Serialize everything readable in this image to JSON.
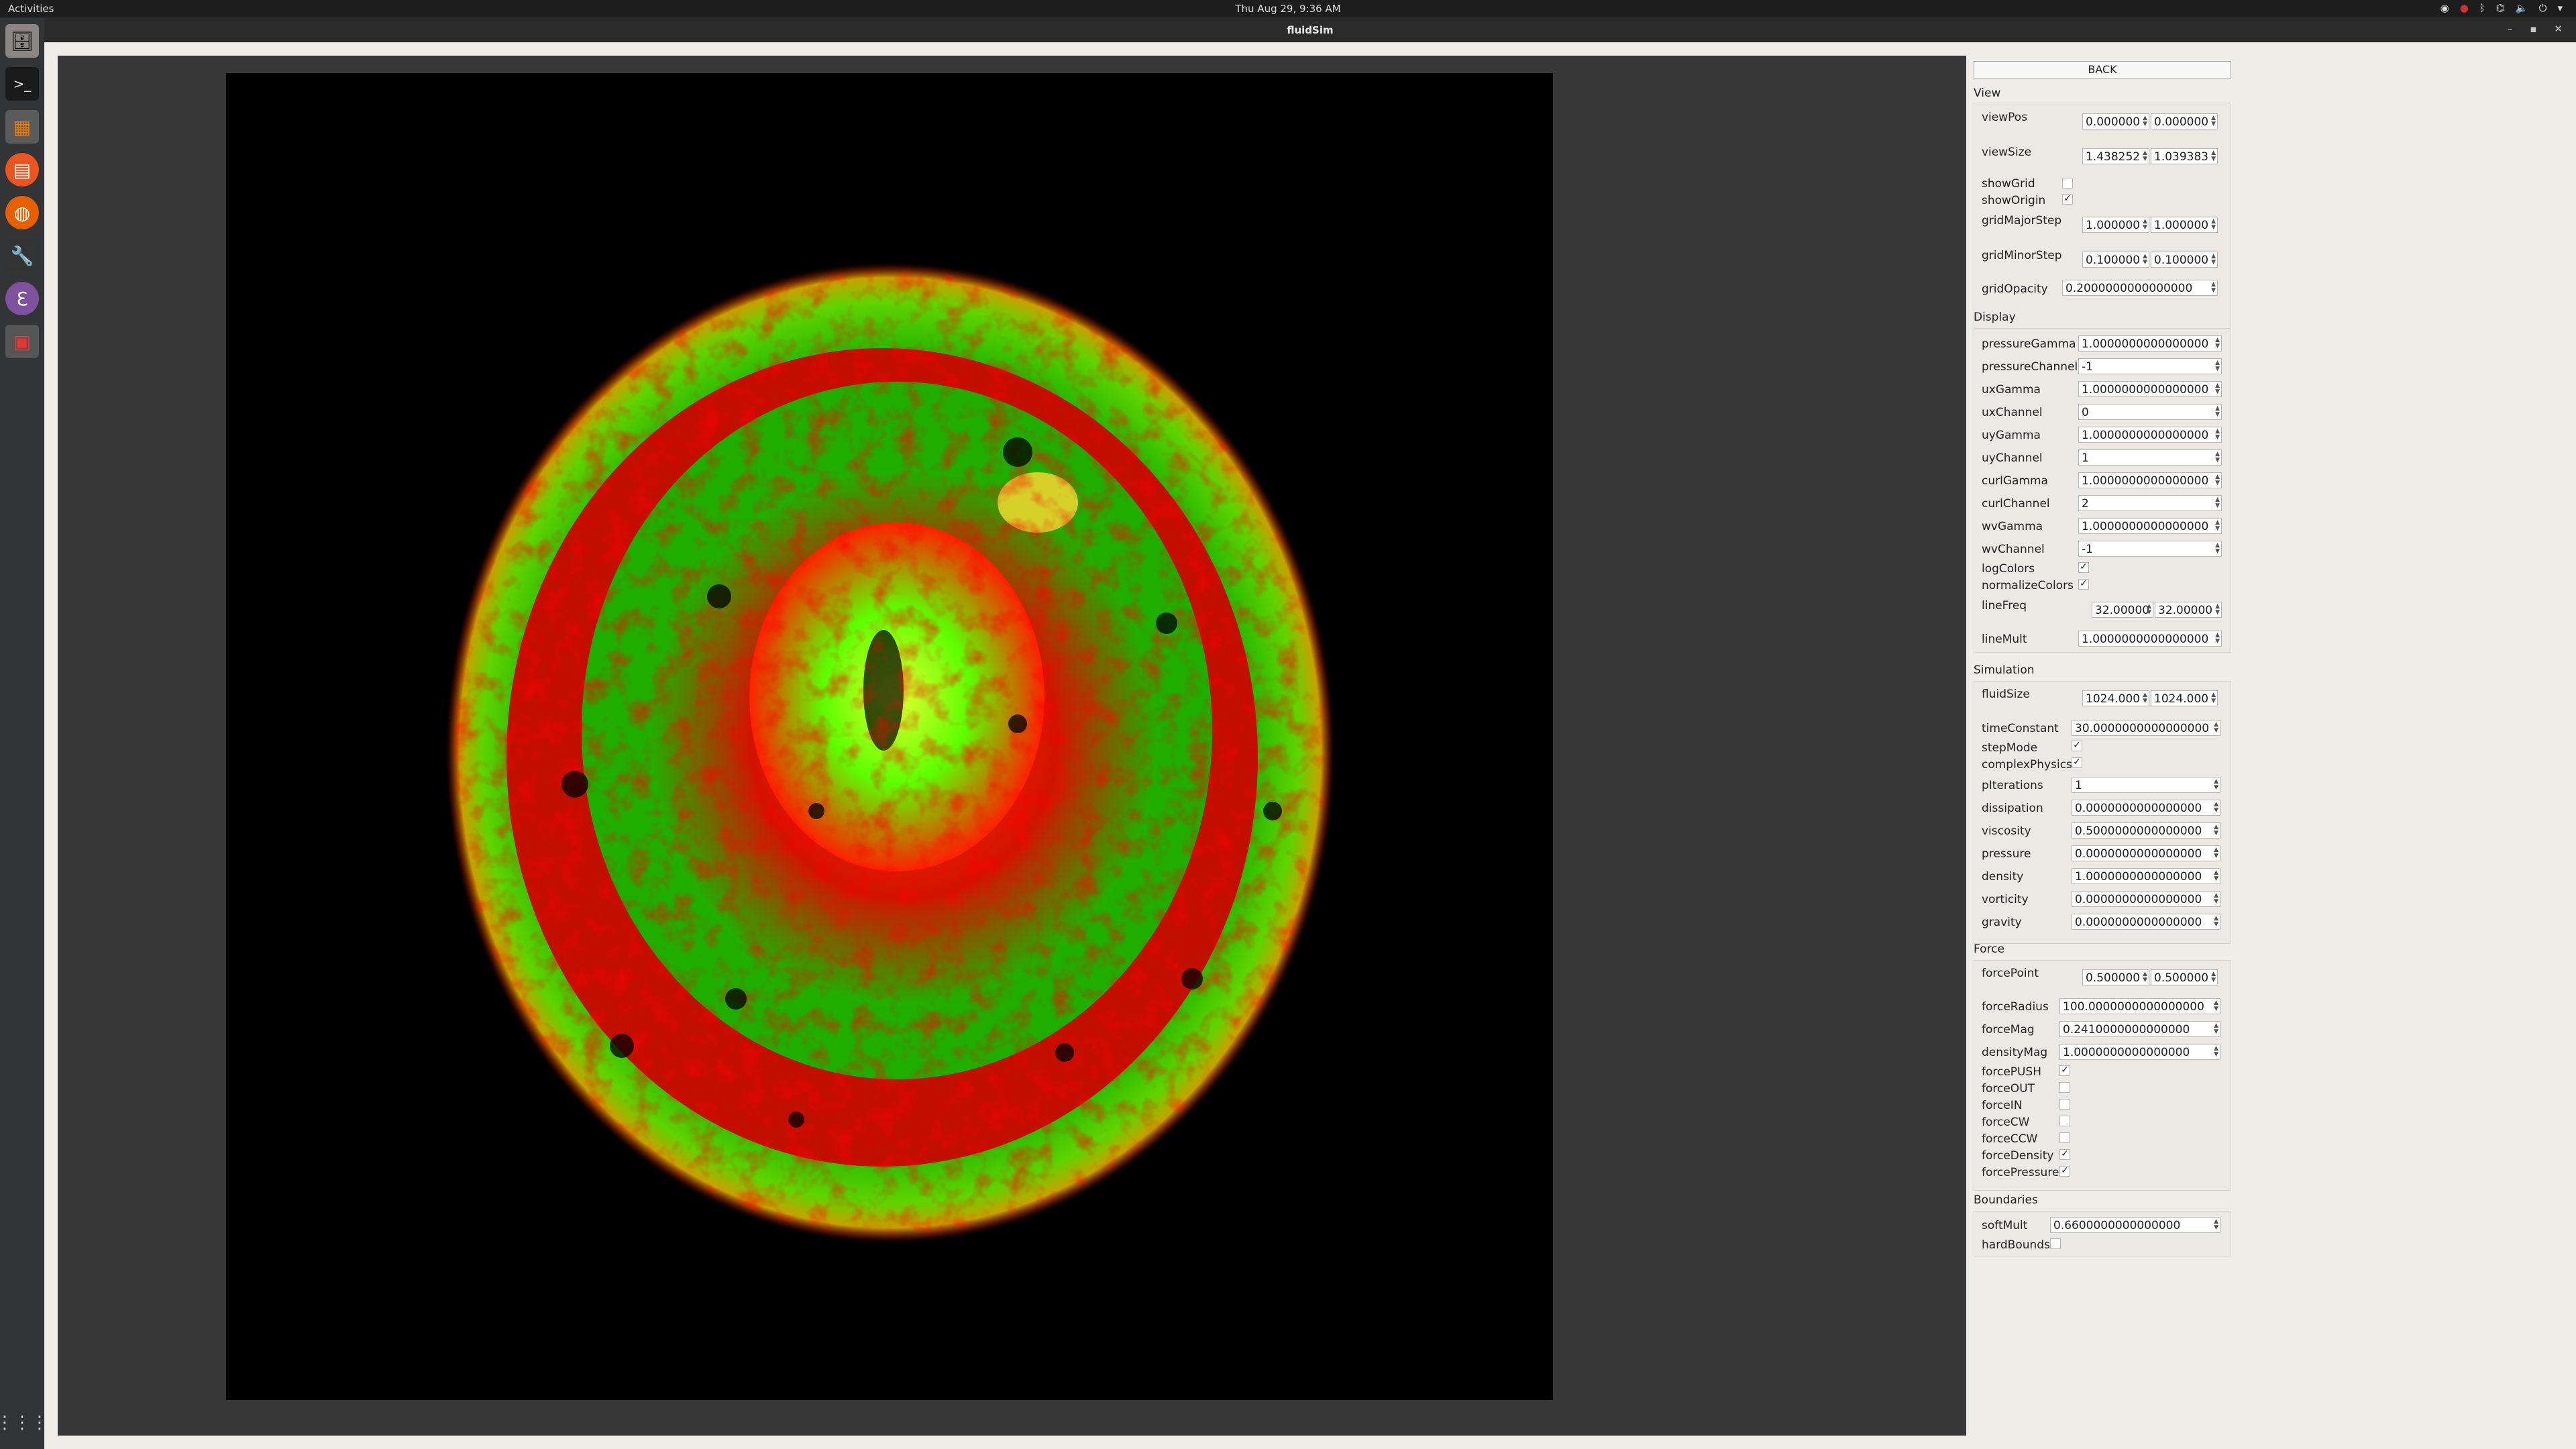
{
  "topbar": {
    "activities": "Activities",
    "clock": "Thu Aug 29,  9:36 AM"
  },
  "window": {
    "title": "fluidSim"
  },
  "panel": {
    "back": "BACK",
    "sections": {
      "view": "View",
      "display": "Display",
      "simulation": "Simulation",
      "force": "Force",
      "boundaries": "Boundaries"
    },
    "view": {
      "viewPos": {
        "label": "viewPos",
        "x": "0.000000",
        "y": "0.000000"
      },
      "viewSize": {
        "label": "viewSize",
        "x": "1.438252",
        "y": "1.039383"
      },
      "showGrid": {
        "label": "showGrid",
        "checked": false
      },
      "showOrigin": {
        "label": "showOrigin",
        "checked": true
      },
      "gridMajorStep": {
        "label": "gridMajorStep",
        "x": "1.000000",
        "y": "1.000000"
      },
      "gridMinorStep": {
        "label": "gridMinorStep",
        "x": "0.100000",
        "y": "0.100000"
      },
      "gridOpacity": {
        "label": "gridOpacity",
        "value": "0.2000000000000000"
      }
    },
    "display": {
      "pressureGamma": {
        "label": "pressureGamma",
        "value": "1.0000000000000000"
      },
      "pressureChannel": {
        "label": "pressureChannel",
        "value": "-1"
      },
      "uxGamma": {
        "label": "uxGamma",
        "value": "1.0000000000000000"
      },
      "uxChannel": {
        "label": "uxChannel",
        "value": "0"
      },
      "uyGamma": {
        "label": "uyGamma",
        "value": "1.0000000000000000"
      },
      "uyChannel": {
        "label": "uyChannel",
        "value": "1"
      },
      "curlGamma": {
        "label": "curlGamma",
        "value": "1.0000000000000000"
      },
      "curlChannel": {
        "label": "curlChannel",
        "value": "2"
      },
      "wvGamma": {
        "label": "wvGamma",
        "value": "1.0000000000000000"
      },
      "wvChannel": {
        "label": "wvChannel",
        "value": "-1"
      },
      "logColors": {
        "label": "logColors",
        "checked": true
      },
      "normalizeColors": {
        "label": "normalizeColors",
        "checked": true
      },
      "lineFreq": {
        "label": "lineFreq",
        "x": "32.00000",
        "y": "32.00000"
      },
      "lineMult": {
        "label": "lineMult",
        "value": "1.0000000000000000"
      }
    },
    "simulation": {
      "fluidSize": {
        "label": "fluidSize",
        "x": "1024.000",
        "y": "1024.000"
      },
      "timeConstant": {
        "label": "timeConstant",
        "value": "30.0000000000000000"
      },
      "stepMode": {
        "label": "stepMode",
        "checked": true
      },
      "complexPhysics": {
        "label": "complexPhysics",
        "checked": true
      },
      "pIterations": {
        "label": "pIterations",
        "value": "1"
      },
      "dissipation": {
        "label": "dissipation",
        "value": "0.0000000000000000"
      },
      "viscosity": {
        "label": "viscosity",
        "value": "0.5000000000000000"
      },
      "pressure": {
        "label": "pressure",
        "value": "0.0000000000000000"
      },
      "density": {
        "label": "density",
        "value": "1.0000000000000000"
      },
      "vorticity": {
        "label": "vorticity",
        "value": "0.0000000000000000"
      },
      "gravity": {
        "label": "gravity",
        "value": "0.0000000000000000"
      }
    },
    "force": {
      "forcePoint": {
        "label": "forcePoint",
        "x": "0.500000",
        "y": "0.500000"
      },
      "forceRadius": {
        "label": "forceRadius",
        "value": "100.0000000000000000"
      },
      "forceMag": {
        "label": "forceMag",
        "value": "0.2410000000000000"
      },
      "densityMag": {
        "label": "densityMag",
        "value": "1.0000000000000000"
      },
      "forcePUSH": {
        "label": "forcePUSH",
        "checked": true
      },
      "forceOUT": {
        "label": "forceOUT",
        "checked": false
      },
      "forceIN": {
        "label": "forceIN",
        "checked": false
      },
      "forceCW": {
        "label": "forceCW",
        "checked": false
      },
      "forceCCW": {
        "label": "forceCCW",
        "checked": false
      },
      "forceDensity": {
        "label": "forceDensity",
        "checked": true
      },
      "forcePressure": {
        "label": "forcePressure",
        "checked": true
      }
    },
    "boundaries": {
      "softMult": {
        "label": "softMult",
        "value": "0.6600000000000000"
      },
      "hardBounds": {
        "label": "hardBounds",
        "checked": false
      }
    }
  }
}
